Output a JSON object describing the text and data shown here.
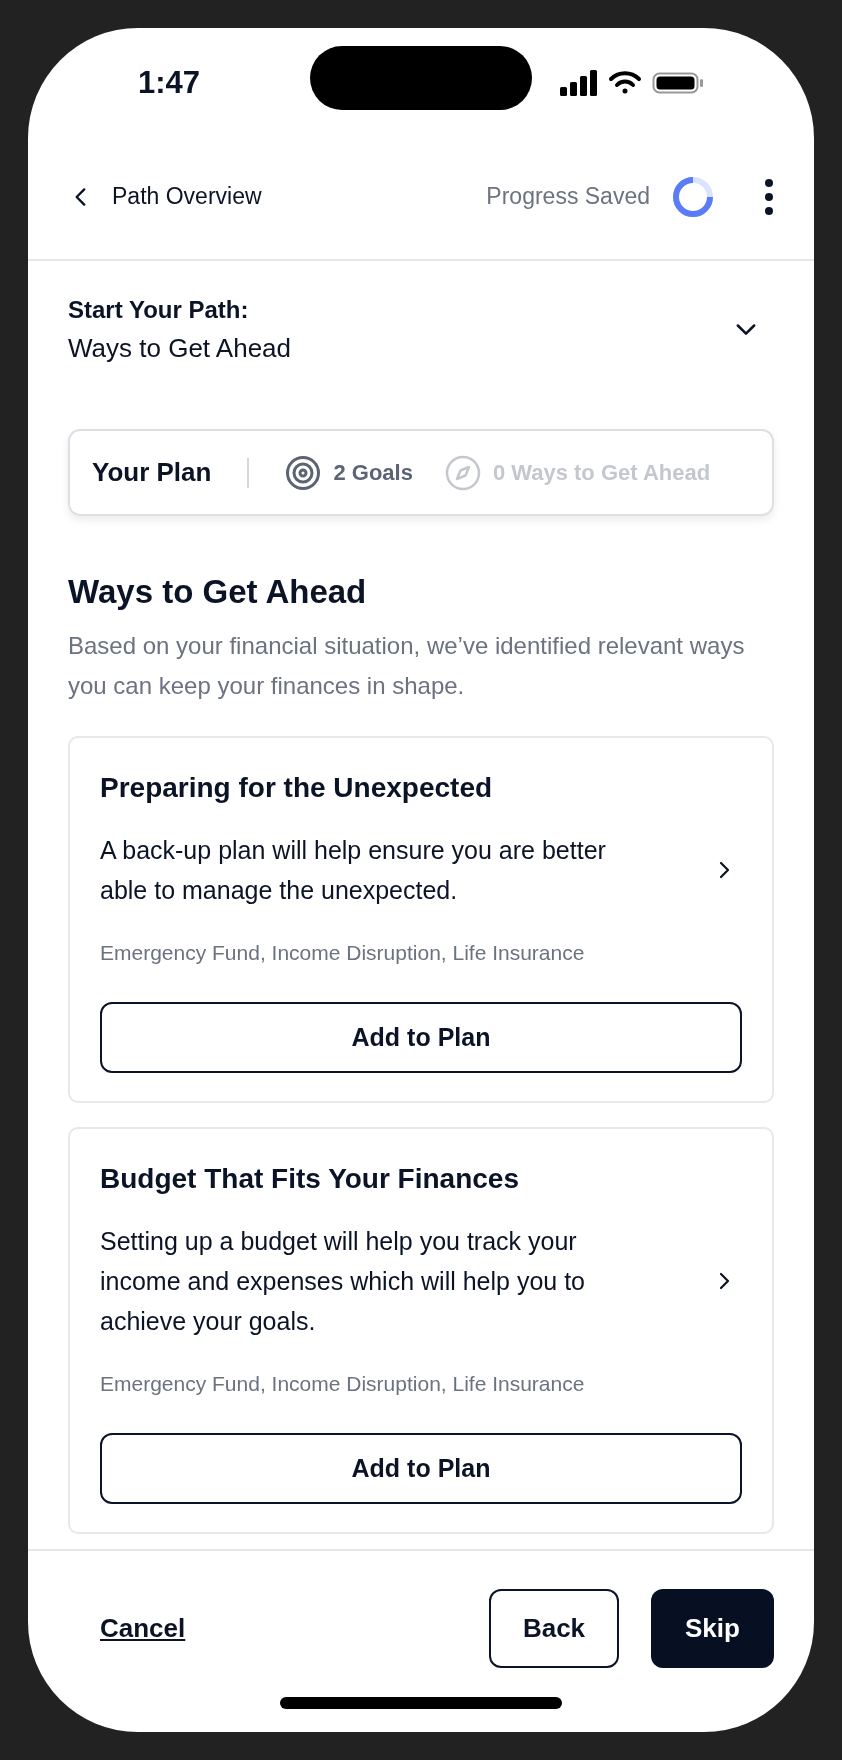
{
  "status_bar": {
    "time": "1:47"
  },
  "header": {
    "back_label": "Path Overview",
    "save_status": "Progress Saved"
  },
  "section": {
    "title": "Start Your Path:",
    "subtitle": "Ways to Get Ahead",
    "expanded": false
  },
  "plan_summary": {
    "label": "Your Plan",
    "items": [
      {
        "kind": "goals",
        "label": "2 Goals",
        "disabled": false
      },
      {
        "kind": "ways",
        "label": "0 Ways to Get Ahead",
        "disabled": true
      }
    ]
  },
  "heading": "Ways to Get Ahead",
  "description": "Based on your financial situation, we’ve identified relevant ways you can keep your finances in shape.",
  "cards": [
    {
      "title": "Preparing for the Unexpected",
      "body": "A back-up plan will help ensure you are better able to manage the unexpected.",
      "tags": "Emergency Fund, Income Disruption, Life Insurance",
      "button": "Add to Plan"
    },
    {
      "title": "Budget That Fits Your Finances",
      "body": "Setting up a budget will help you track your income and expenses which will help you to achieve your goals.",
      "tags": "Emergency Fund, Income Disruption, Life Insurance",
      "button": "Add to Plan"
    }
  ],
  "footer": {
    "cancel": "Cancel",
    "back": "Back",
    "skip": "Skip"
  }
}
